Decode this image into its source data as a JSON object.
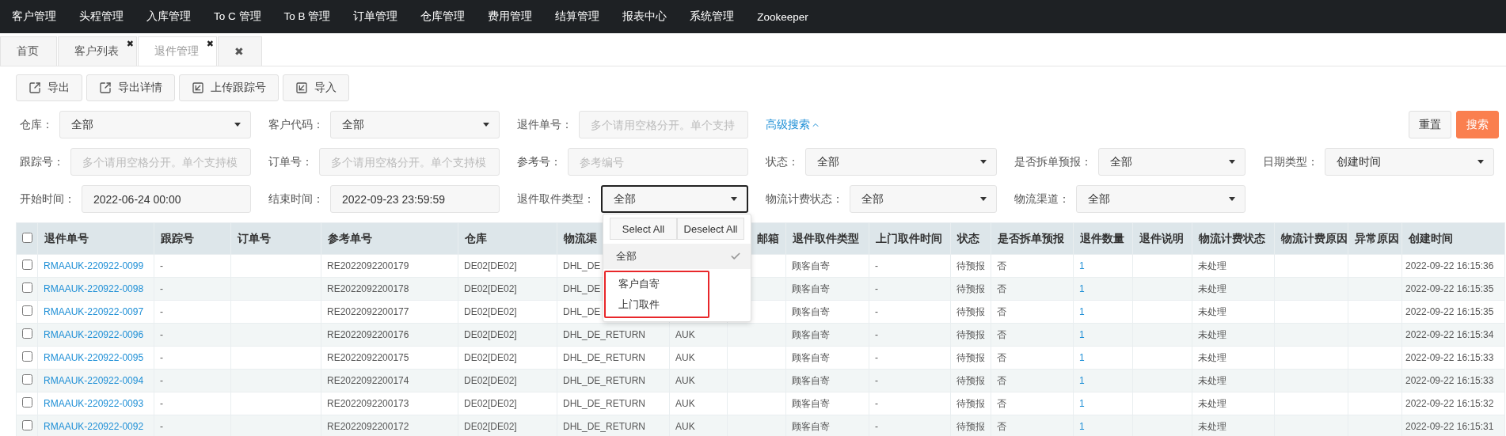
{
  "nav": {
    "items": [
      "客户管理",
      "头程管理",
      "入库管理",
      "To C 管理",
      "To B 管理",
      "订单管理",
      "仓库管理",
      "费用管理",
      "结算管理",
      "报表中心",
      "系统管理",
      "Zookeeper"
    ]
  },
  "tabs": [
    {
      "label": "首页",
      "selected": false
    },
    {
      "label": "客户列表",
      "selected": false,
      "close": "✖"
    },
    {
      "label": "退件管理",
      "selected": true,
      "close": "✖"
    },
    {
      "label": "✖",
      "selected": false
    }
  ],
  "toolbar": [
    {
      "label": "导出",
      "kind": "export"
    },
    {
      "label": "导出详情",
      "kind": "export"
    },
    {
      "label": "上传跟踪号",
      "kind": "import"
    },
    {
      "label": "导入",
      "kind": "import"
    }
  ],
  "filters": {
    "rows": [
      [
        {
          "label": "仓库：",
          "kind": "select",
          "value": "全部"
        },
        {
          "label": "客户代码：",
          "kind": "select",
          "value": "全部"
        },
        {
          "label": "退件单号：",
          "kind": "input",
          "placeholder": "多个请用空格分开。单个支持"
        }
      ],
      [
        {
          "label": "跟踪号：",
          "kind": "input",
          "placeholder": "多个请用空格分开。单个支持模"
        },
        {
          "label": "订单号：",
          "kind": "input",
          "placeholder": "多个请用空格分开。单个支持模"
        },
        {
          "label": "参考号：",
          "kind": "input",
          "placeholder": "参考编号"
        },
        {
          "label": "状态：",
          "kind": "select",
          "value": "全部"
        },
        {
          "label": "是否拆单预报：",
          "kind": "select",
          "value": "全部"
        },
        {
          "label": "日期类型：",
          "kind": "select",
          "value": "创建时间"
        }
      ],
      [
        {
          "label": "开始时间：",
          "kind": "input",
          "value": "2022-06-24 00:00"
        },
        {
          "label": "结束时间：",
          "kind": "input",
          "value": "2022-09-23 23:59:59"
        },
        {
          "label": "退件取件类型：",
          "kind": "select",
          "value": "全部",
          "focused": true,
          "open": true
        },
        {
          "label": "物流计费状态：",
          "kind": "select",
          "value": "全部"
        },
        {
          "label": "物流渠道：",
          "kind": "select",
          "value": "全部"
        }
      ]
    ],
    "advanced_search": "高级搜索",
    "actions": [
      {
        "label": "重置",
        "kind": "default"
      },
      {
        "label": "搜索",
        "kind": "primary"
      }
    ]
  },
  "dropdown": {
    "select_all": "Select All",
    "deselect_all": "Deselect All",
    "options": [
      {
        "label": "全部",
        "selected": true,
        "annotated": false
      },
      {
        "label": "客户自寄",
        "selected": false,
        "annotated": true
      },
      {
        "label": "上门取件",
        "selected": false,
        "annotated": true
      }
    ]
  },
  "table": {
    "header_checked": false,
    "columns": [
      {
        "label": "退件单号",
        "kind": "link"
      },
      {
        "label": "跟踪号"
      },
      {
        "label": "订单号"
      },
      {
        "label": "参考单号"
      },
      {
        "label": "仓库"
      },
      {
        "label": "物流渠"
      },
      {},
      {
        "label": "邮箱"
      },
      {
        "label": "退件取件类型"
      },
      {
        "label": "上门取件时间"
      },
      {
        "label": "状态"
      },
      {
        "label": "是否拆单预报"
      },
      {
        "label": "退件数量",
        "kind": "link"
      },
      {
        "label": "退件说明"
      },
      {
        "label": "物流计费状态"
      },
      {
        "label": "物流计费原因"
      },
      {
        "label": "异常原因"
      },
      {
        "label": "创建时间"
      }
    ],
    "rows": [
      {
        "checked": false,
        "cells": [
          "RMAAUK-220922-0099",
          "-",
          null,
          "RE2022092200179",
          "DE02[DE02]",
          "DHL_DE",
          null,
          null,
          "顾客自寄",
          "-",
          "待预报",
          "否",
          "1",
          null,
          "未处理",
          null,
          null,
          "2022-09-22 16:15:36"
        ]
      },
      {
        "checked": false,
        "cells": [
          "RMAAUK-220922-0098",
          "-",
          null,
          "RE2022092200178",
          "DE02[DE02]",
          "DHL_DE",
          null,
          null,
          "顾客自寄",
          "-",
          "待预报",
          "否",
          "1",
          null,
          "未处理",
          null,
          null,
          "2022-09-22 16:15:35"
        ]
      },
      {
        "checked": false,
        "cells": [
          "RMAAUK-220922-0097",
          "-",
          null,
          "RE2022092200177",
          "DE02[DE02]",
          "DHL_DE",
          null,
          null,
          "顾客自寄",
          "-",
          "待预报",
          "否",
          "1",
          null,
          "未处理",
          null,
          null,
          "2022-09-22 16:15:35"
        ]
      },
      {
        "checked": false,
        "cells": [
          "RMAAUK-220922-0096",
          "-",
          null,
          "RE2022092200176",
          "DE02[DE02]",
          "DHL_DE_RETURN",
          "AUK",
          null,
          "顾客自寄",
          "-",
          "待预报",
          "否",
          "1",
          null,
          "未处理",
          null,
          null,
          "2022-09-22 16:15:34"
        ]
      },
      {
        "checked": false,
        "cells": [
          "RMAAUK-220922-0095",
          "-",
          null,
          "RE2022092200175",
          "DE02[DE02]",
          "DHL_DE_RETURN",
          "AUK",
          null,
          "顾客自寄",
          "-",
          "待预报",
          "否",
          "1",
          null,
          "未处理",
          null,
          null,
          "2022-09-22 16:15:33"
        ]
      },
      {
        "checked": false,
        "cells": [
          "RMAAUK-220922-0094",
          "-",
          null,
          "RE2022092200174",
          "DE02[DE02]",
          "DHL_DE_RETURN",
          "AUK",
          null,
          "顾客自寄",
          "-",
          "待预报",
          "否",
          "1",
          null,
          "未处理",
          null,
          null,
          "2022-09-22 16:15:33"
        ]
      },
      {
        "checked": false,
        "cells": [
          "RMAAUK-220922-0093",
          "-",
          null,
          "RE2022092200173",
          "DE02[DE02]",
          "DHL_DE_RETURN",
          "AUK",
          null,
          "顾客自寄",
          "-",
          "待预报",
          "否",
          "1",
          null,
          "未处理",
          null,
          null,
          "2022-09-22 16:15:32"
        ]
      },
      {
        "checked": false,
        "cells": [
          "RMAAUK-220922-0092",
          "-",
          null,
          "RE2022092200172",
          "DE02[DE02]",
          "DHL_DE_RETURN",
          "AUK",
          null,
          "顾客自寄",
          "-",
          "待预报",
          "否",
          "1",
          null,
          "未处理",
          null,
          null,
          "2022-09-22 16:15:31"
        ]
      }
    ]
  }
}
